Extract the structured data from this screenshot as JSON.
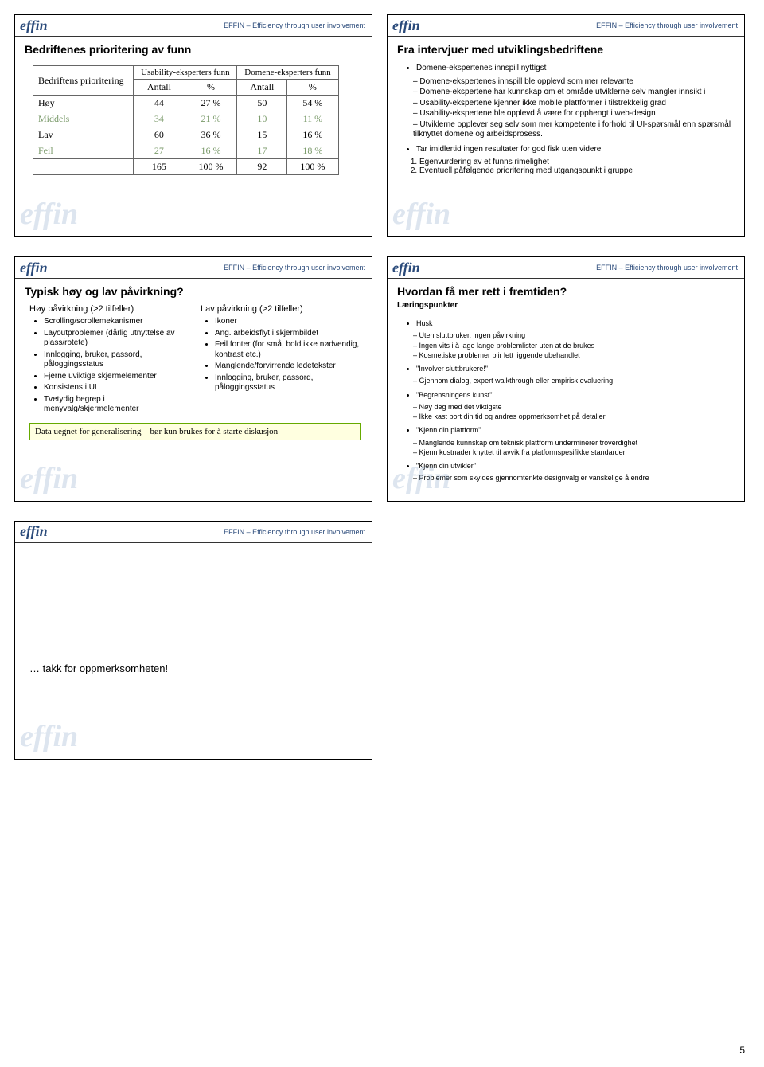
{
  "page_number": "5",
  "brand": {
    "logo": "effin",
    "tagline": "EFFIN – Efficiency through user involvement"
  },
  "chart_data": {
    "type": "table",
    "title": "Bedriftenes prioritering av funn",
    "row_header": "Bedriftens prioritering",
    "groups": [
      "Usability-eksperters funn",
      "Domene-eksperters funn"
    ],
    "sub_headers": [
      "Antall",
      "%",
      "Antall",
      "%"
    ],
    "rows": [
      {
        "label": "Høy",
        "dim": false,
        "cells": [
          "44",
          "27 %",
          "50",
          "54 %"
        ]
      },
      {
        "label": "Middels",
        "dim": true,
        "cells": [
          "34",
          "21 %",
          "10",
          "11 %"
        ]
      },
      {
        "label": "Lav",
        "dim": false,
        "cells": [
          "60",
          "36 %",
          "15",
          "16 %"
        ]
      },
      {
        "label": "Feil",
        "dim": true,
        "cells": [
          "27",
          "16 %",
          "17",
          "18 %"
        ]
      },
      {
        "label": "",
        "dim": false,
        "cells": [
          "165",
          "100 %",
          "92",
          "100 %"
        ]
      }
    ]
  },
  "slide2": {
    "title": "Fra intervjuer med utviklingsbedriftene",
    "b1": "Domene-ekspertenes innspill nyttigst",
    "d1": "Domene-ekspertenes innspill ble opplevd som mer relevante",
    "d2": "Domene-ekspertene har kunnskap om et område utviklerne selv mangler innsikt i",
    "d3": "Usability-ekspertene kjenner ikke mobile plattformer i tilstrekkelig grad",
    "d4": "Usability-ekspertene ble opplevd å være for opphengt i web-design",
    "d5": "Utviklerne opplever seg selv som mer kompetente i forhold til UI-spørsmål enn spørsmål tilknyttet domene og arbeidsprosess.",
    "b2": "Tar imidlertid ingen resultater for god fisk uten videre",
    "n1": "Egenvurdering av et funns rimelighet",
    "n2": "Eventuell påfølgende prioritering med utgangspunkt i gruppe"
  },
  "slide3": {
    "title": "Typisk høy og lav påvirkning?",
    "left_head": "Høy påvirkning (>2 tilfeller)",
    "right_head": "Lav påvirkning (>2 tilfeller)",
    "left": [
      "Scrolling/scrollemekanismer",
      "Layoutproblemer (dårlig utnyttelse av plass/rotete)",
      "Innlogging, bruker, passord, påloggingsstatus",
      "Fjerne uviktige skjermelementer",
      "Konsistens i UI",
      "Tvetydig begrep i menyvalg/skjermelementer"
    ],
    "right": [
      "Ikoner",
      "Ang. arbeidsflyt i skjermbildet",
      "Feil fonter (for små, bold ikke nødvendig, kontrast etc.)",
      "Manglende/forvirrende ledetekster",
      "Innlogging, bruker, passord, påloggingsstatus"
    ],
    "note": "Data uegnet for generalisering – bør kun brukes for å starte diskusjon"
  },
  "slide4": {
    "title": "Hvordan få mer rett i fremtiden?",
    "subtitle": "Læringspunkter",
    "b1": "Husk",
    "b1d": [
      "Uten sluttbruker, ingen påvirkning",
      "Ingen vits i å lage lange problemlister uten at de brukes",
      "Kosmetiske problemer blir lett liggende ubehandlet"
    ],
    "b2": "\"Involver sluttbrukere!\"",
    "b2d": [
      "Gjennom dialog, expert walkthrough eller empirisk evaluering"
    ],
    "b3": "\"Begrensningens kunst\"",
    "b3d": [
      "Nøy deg med det viktigste",
      "Ikke kast bort din tid og andres oppmerksomhet på detaljer"
    ],
    "b4": "\"Kjenn din plattform\"",
    "b4d": [
      "Manglende kunnskap om teknisk plattform underminerer troverdighet",
      "Kjenn kostnader knyttet til avvik fra platformspesifikke standarder"
    ],
    "b5": "\"Kjenn din utvikler\"",
    "b5d": [
      "Problemer som skyldes gjennomtenkte designvalg er vanskelige å endre"
    ]
  },
  "slide5": {
    "text": "… takk for oppmerksomheten!"
  }
}
